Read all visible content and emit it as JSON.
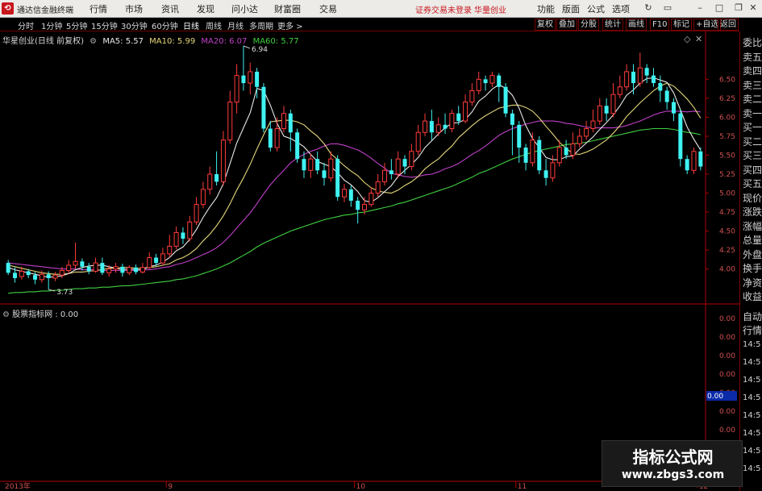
{
  "menubar": {
    "logo_glyph": "⟲",
    "app_title": "通达信金融终端",
    "items": [
      "行情",
      "市场",
      "资讯",
      "发现",
      "问小达",
      "财富圈",
      "交易"
    ],
    "status_text": "证券交易未登录",
    "broker": "华量创业",
    "right_items": [
      "功能",
      "版面",
      "公式",
      "选项"
    ]
  },
  "periodbar": {
    "items": [
      "分时",
      "1分钟",
      "5分钟",
      "15分钟",
      "30分钟",
      "60分钟",
      "日线",
      "周线",
      "月线",
      "多周期",
      "更多 >"
    ],
    "active": "日线",
    "right_buttons": [
      "复权",
      "叠加",
      "分股",
      "统计",
      "画线",
      "F10",
      "标记",
      "+自选",
      "返回"
    ]
  },
  "infoline": {
    "name": "华星创业(日线 前复权)",
    "ma5": "MA5: 5.57",
    "ma10": "MA10: 5.99",
    "ma20": "MA20: 6.07",
    "ma60": "MA60: 5.77"
  },
  "colors": {
    "up": "#ff3b3b",
    "down": "#3ff2f2",
    "ma5": "#e8e8e8",
    "ma10": "#e5d77a",
    "ma20": "#c040c8",
    "ma60": "#40d040",
    "axis": "#b00000",
    "grid": "#5a0000"
  },
  "sidepanel": {
    "top_items": [
      "委比",
      "卖五",
      "卖四",
      "卖三",
      "卖二",
      "卖一",
      "买一",
      "买二",
      "买三",
      "买四",
      "买五",
      "现价",
      "涨跌",
      "涨幅",
      "总量",
      "外盘",
      "换手",
      "净资",
      "收益"
    ],
    "bottom_items": [
      "自动",
      "行情"
    ]
  },
  "subchart": {
    "label": "股票指标网 : 0.00",
    "axis_values": [
      "0.00",
      "0.00",
      "0.00",
      "0.00",
      "0.00",
      "0.00",
      "0.00"
    ],
    "highlight_value": "0.00",
    "times": [
      "14:5",
      "14:5",
      "14:5",
      "14:5",
      "14:5",
      "14:5",
      "14:5",
      "14:5"
    ]
  },
  "chart_data": {
    "type": "candlestick",
    "y_ticks": [
      "6.50",
      "6.25",
      "6.00",
      "5.75",
      "5.50",
      "5.25",
      "5.00",
      "4.75",
      "4.50",
      "4.25",
      "4.00"
    ],
    "ylim": [
      3.55,
      6.95
    ],
    "x_labels": [
      "2013年",
      "9",
      "10",
      "11",
      "12"
    ],
    "annotations": {
      "high": "6.94",
      "low": "3.73"
    },
    "candles": [
      [
        4.08,
        3.95,
        4.12,
        3.92
      ],
      [
        3.95,
        3.88,
        4.02,
        3.82
      ],
      [
        3.9,
        3.97,
        4.03,
        3.86
      ],
      [
        3.97,
        3.92,
        4.0,
        3.88
      ],
      [
        3.92,
        3.86,
        3.96,
        3.8
      ],
      [
        3.86,
        3.93,
        3.98,
        3.82
      ],
      [
        3.93,
        3.88,
        3.97,
        3.73
      ],
      [
        3.88,
        3.92,
        3.96,
        3.84
      ],
      [
        3.92,
        3.98,
        4.03,
        3.88
      ],
      [
        3.98,
        4.05,
        4.12,
        3.94
      ],
      [
        4.05,
        4.1,
        4.35,
        4.0
      ],
      [
        4.1,
        4.03,
        4.14,
        3.98
      ],
      [
        4.03,
        3.97,
        4.08,
        3.93
      ],
      [
        3.97,
        4.08,
        4.15,
        3.95
      ],
      [
        4.08,
        3.95,
        4.15,
        3.92
      ],
      [
        3.95,
        4.0,
        4.05,
        3.9
      ],
      [
        4.0,
        4.03,
        4.08,
        3.95
      ],
      [
        4.03,
        3.95,
        4.07,
        3.9
      ],
      [
        3.95,
        4.02,
        4.05,
        3.92
      ],
      [
        4.02,
        3.96,
        4.06,
        3.93
      ],
      [
        3.96,
        4.02,
        4.08,
        3.94
      ],
      [
        4.02,
        4.15,
        4.22,
        4.0
      ],
      [
        4.15,
        4.08,
        4.2,
        4.04
      ],
      [
        4.08,
        4.2,
        4.28,
        4.05
      ],
      [
        4.2,
        4.3,
        4.45,
        4.15
      ],
      [
        4.3,
        4.48,
        4.56,
        4.26
      ],
      [
        4.48,
        4.4,
        4.55,
        4.33
      ],
      [
        4.4,
        4.62,
        4.7,
        4.36
      ],
      [
        4.62,
        4.85,
        4.95,
        4.58
      ],
      [
        4.85,
        5.05,
        5.15,
        4.8
      ],
      [
        5.05,
        5.25,
        5.35,
        4.98
      ],
      [
        5.25,
        5.15,
        5.55,
        5.1
      ],
      [
        5.15,
        5.7,
        5.82,
        5.1
      ],
      [
        5.7,
        6.2,
        6.35,
        5.65
      ],
      [
        6.2,
        6.55,
        6.7,
        6.05
      ],
      [
        6.55,
        6.45,
        6.94,
        6.35
      ],
      [
        6.45,
        6.6,
        6.72,
        6.3
      ],
      [
        6.6,
        6.4,
        6.65,
        6.25
      ],
      [
        6.4,
        5.85,
        6.45,
        5.8
      ],
      [
        5.85,
        5.6,
        5.95,
        5.55
      ],
      [
        5.6,
        5.85,
        6.0,
        5.55
      ],
      [
        5.85,
        6.05,
        6.15,
        5.8
      ],
      [
        6.05,
        5.8,
        6.1,
        5.55
      ],
      [
        5.8,
        5.45,
        5.85,
        5.4
      ],
      [
        5.45,
        5.3,
        5.55,
        5.2
      ],
      [
        5.3,
        5.45,
        5.52,
        5.2
      ],
      [
        5.45,
        5.3,
        5.55,
        5.25
      ],
      [
        5.3,
        5.2,
        5.4,
        5.1
      ],
      [
        5.2,
        5.45,
        5.55,
        5.15
      ],
      [
        5.45,
        4.95,
        5.5,
        4.9
      ],
      [
        4.95,
        5.05,
        5.12,
        4.88
      ],
      [
        5.05,
        4.9,
        5.1,
        4.82
      ],
      [
        4.9,
        4.78,
        4.95,
        4.6
      ],
      [
        4.78,
        4.85,
        4.95,
        4.72
      ],
      [
        4.85,
        5.0,
        5.08,
        4.82
      ],
      [
        5.0,
        5.15,
        5.25,
        4.95
      ],
      [
        5.15,
        5.3,
        5.4,
        5.1
      ],
      [
        5.3,
        5.25,
        5.45,
        5.18
      ],
      [
        5.25,
        5.45,
        5.55,
        5.2
      ],
      [
        5.45,
        5.35,
        5.5,
        5.25
      ],
      [
        5.35,
        5.55,
        5.65,
        5.3
      ],
      [
        5.55,
        5.8,
        5.9,
        5.5
      ],
      [
        5.8,
        5.95,
        6.05,
        5.75
      ],
      [
        5.95,
        5.8,
        6.1,
        5.7
      ],
      [
        5.8,
        5.9,
        6.0,
        5.75
      ],
      [
        5.9,
        5.85,
        6.05,
        5.78
      ],
      [
        5.85,
        6.05,
        6.1,
        5.8
      ],
      [
        6.05,
        5.95,
        6.15,
        5.9
      ],
      [
        5.95,
        6.2,
        6.3,
        5.92
      ],
      [
        6.2,
        6.35,
        6.45,
        6.15
      ],
      [
        6.35,
        6.5,
        6.6,
        6.3
      ],
      [
        6.5,
        6.45,
        6.55,
        6.35
      ],
      [
        6.45,
        6.55,
        6.6,
        6.4
      ],
      [
        6.55,
        6.4,
        6.58,
        6.2
      ],
      [
        6.4,
        6.05,
        6.45,
        6.0
      ],
      [
        6.05,
        5.9,
        6.1,
        5.5
      ],
      [
        5.9,
        5.6,
        5.95,
        5.4
      ],
      [
        5.6,
        5.4,
        5.65,
        5.3
      ],
      [
        5.4,
        5.7,
        5.8,
        5.35
      ],
      [
        5.7,
        5.3,
        5.75,
        5.25
      ],
      [
        5.3,
        5.2,
        5.45,
        5.1
      ],
      [
        5.2,
        5.4,
        5.5,
        5.15
      ],
      [
        5.4,
        5.6,
        5.7,
        5.35
      ],
      [
        5.6,
        5.5,
        5.7,
        5.45
      ],
      [
        5.5,
        5.65,
        5.8,
        5.45
      ],
      [
        5.65,
        5.75,
        5.85,
        5.6
      ],
      [
        5.75,
        5.85,
        5.95,
        5.7
      ],
      [
        5.85,
        5.95,
        6.1,
        5.8
      ],
      [
        5.95,
        6.15,
        6.25,
        5.9
      ],
      [
        6.15,
        6.05,
        6.25,
        5.95
      ],
      [
        6.05,
        6.3,
        6.45,
        6.0
      ],
      [
        6.3,
        6.4,
        6.55,
        6.25
      ],
      [
        6.4,
        6.6,
        6.7,
        6.35
      ],
      [
        6.6,
        6.45,
        6.7,
        6.3
      ],
      [
        6.45,
        6.65,
        6.85,
        6.4
      ],
      [
        6.65,
        6.55,
        6.7,
        6.45
      ],
      [
        6.55,
        6.45,
        6.65,
        6.4
      ],
      [
        6.45,
        6.35,
        6.55,
        6.2
      ],
      [
        6.35,
        6.2,
        6.4,
        6.1
      ],
      [
        6.2,
        6.05,
        6.25,
        5.95
      ],
      [
        6.05,
        5.45,
        6.1,
        5.35
      ],
      [
        5.45,
        5.3,
        5.5,
        5.25
      ],
      [
        5.3,
        5.55,
        5.6,
        5.25
      ],
      [
        5.55,
        5.35,
        5.6,
        5.3
      ]
    ],
    "ma5": [
      4.02,
      3.99,
      3.97,
      3.95,
      3.93,
      3.91,
      3.89,
      3.9,
      3.91,
      3.94,
      3.99,
      4.02,
      4.04,
      4.05,
      4.05,
      4.03,
      4.01,
      3.99,
      4.0,
      3.99,
      3.99,
      4.03,
      4.05,
      4.09,
      4.15,
      4.24,
      4.29,
      4.39,
      4.52,
      4.68,
      4.82,
      4.94,
      5.12,
      5.39,
      5.66,
      5.86,
      6.06,
      6.38,
      6.35,
      6.16,
      5.92,
      5.75,
      5.72,
      5.67,
      5.61,
      5.51,
      5.42,
      5.38,
      5.35,
      5.27,
      5.17,
      5.11,
      5.02,
      4.9,
      4.88,
      4.94,
      5.02,
      5.1,
      5.22,
      5.3,
      5.38,
      5.47,
      5.6,
      5.69,
      5.78,
      5.86,
      5.92,
      5.93,
      5.97,
      6.07,
      6.21,
      6.28,
      6.37,
      6.43,
      6.38,
      6.29,
      6.12,
      5.89,
      5.72,
      5.6,
      5.47,
      5.44,
      5.44,
      5.48,
      5.49,
      5.58,
      5.66,
      5.74,
      5.84,
      5.93,
      6.03,
      6.15,
      6.29,
      6.36,
      6.45,
      6.51,
      6.52,
      6.49,
      6.46,
      6.32,
      6.1,
      5.87,
      5.71,
      5.57
    ],
    "ma10": [
      4.05,
      4.03,
      4.01,
      3.99,
      3.97,
      3.95,
      3.94,
      3.93,
      3.93,
      3.94,
      3.96,
      3.96,
      3.97,
      3.98,
      3.99,
      4.01,
      4.01,
      4.02,
      4.02,
      4.01,
      4.01,
      4.02,
      4.03,
      4.05,
      4.07,
      4.12,
      4.15,
      4.2,
      4.27,
      4.37,
      4.46,
      4.57,
      4.7,
      4.86,
      5.04,
      5.2,
      5.38,
      5.58,
      5.77,
      5.94,
      5.95,
      5.96,
      5.96,
      5.94,
      5.9,
      5.82,
      5.75,
      5.65,
      5.52,
      5.44,
      5.36,
      5.29,
      5.23,
      5.14,
      5.07,
      5.03,
      5.01,
      5.0,
      5.04,
      5.1,
      5.15,
      5.22,
      5.32,
      5.39,
      5.45,
      5.54,
      5.62,
      5.73,
      5.81,
      5.89,
      5.96,
      6.02,
      6.07,
      6.12,
      6.14,
      6.16,
      6.16,
      6.13,
      6.08,
      5.99,
      5.88,
      5.78,
      5.67,
      5.59,
      5.52,
      5.51,
      5.54,
      5.58,
      5.64,
      5.7,
      5.79,
      5.89,
      6.01,
      6.1,
      6.19,
      6.27,
      6.35,
      6.41,
      6.45,
      6.41,
      6.33,
      6.24,
      6.13,
      5.99
    ],
    "ma20": [
      4.08,
      4.07,
      4.06,
      4.05,
      4.04,
      4.03,
      4.02,
      4.01,
      4.0,
      4.0,
      4.0,
      3.99,
      3.99,
      3.99,
      3.98,
      3.98,
      3.98,
      3.98,
      3.98,
      3.98,
      3.99,
      3.99,
      4.0,
      4.02,
      4.03,
      4.06,
      4.08,
      4.11,
      4.15,
      4.19,
      4.23,
      4.28,
      4.35,
      4.44,
      4.54,
      4.64,
      4.74,
      4.86,
      4.99,
      5.11,
      5.21,
      5.3,
      5.4,
      5.46,
      5.51,
      5.55,
      5.58,
      5.62,
      5.65,
      5.65,
      5.63,
      5.6,
      5.57,
      5.52,
      5.46,
      5.39,
      5.33,
      5.26,
      5.24,
      5.22,
      5.21,
      5.22,
      5.24,
      5.25,
      5.28,
      5.32,
      5.35,
      5.39,
      5.45,
      5.51,
      5.56,
      5.62,
      5.69,
      5.76,
      5.81,
      5.85,
      5.88,
      5.91,
      5.93,
      5.95,
      5.95,
      5.95,
      5.94,
      5.92,
      5.91,
      5.89,
      5.87,
      5.86,
      5.86,
      5.86,
      5.86,
      5.87,
      5.89,
      5.92,
      5.95,
      5.99,
      6.03,
      6.06,
      6.08,
      6.08,
      6.08,
      6.07,
      6.08,
      6.07
    ],
    "ma60": [
      3.68,
      3.69,
      3.69,
      3.7,
      3.7,
      3.71,
      3.71,
      3.72,
      3.72,
      3.73,
      3.74,
      3.74,
      3.75,
      3.75,
      3.76,
      3.76,
      3.77,
      3.78,
      3.78,
      3.79,
      3.8,
      3.81,
      3.82,
      3.83,
      3.84,
      3.86,
      3.87,
      3.89,
      3.91,
      3.94,
      3.97,
      4.0,
      4.04,
      4.08,
      4.13,
      4.18,
      4.23,
      4.29,
      4.34,
      4.38,
      4.42,
      4.46,
      4.5,
      4.53,
      4.56,
      4.59,
      4.62,
      4.65,
      4.67,
      4.69,
      4.71,
      4.72,
      4.74,
      4.75,
      4.77,
      4.79,
      4.81,
      4.83,
      4.86,
      4.88,
      4.91,
      4.94,
      4.97,
      5.0,
      5.03,
      5.06,
      5.09,
      5.13,
      5.17,
      5.21,
      5.26,
      5.29,
      5.33,
      5.37,
      5.41,
      5.45,
      5.48,
      5.51,
      5.54,
      5.56,
      5.58,
      5.6,
      5.62,
      5.64,
      5.65,
      5.66,
      5.67,
      5.69,
      5.71,
      5.73,
      5.75,
      5.77,
      5.79,
      5.81,
      5.83,
      5.84,
      5.85,
      5.85,
      5.85,
      5.84,
      5.82,
      5.8,
      5.79,
      5.77
    ]
  }
}
